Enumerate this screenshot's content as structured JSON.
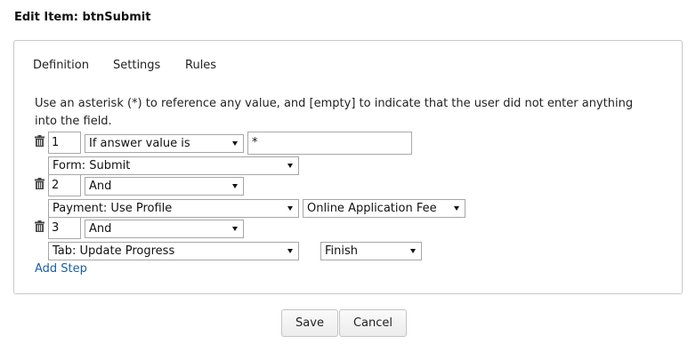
{
  "dialog": {
    "title": "Edit Item: btnSubmit"
  },
  "tabs": [
    {
      "label": "Definition"
    },
    {
      "label": "Settings"
    },
    {
      "label": "Rules"
    }
  ],
  "rules": {
    "description": "Use an asterisk (*) to reference any value, and [empty] to indicate that the user did not enter anything into the field.",
    "steps": [
      {
        "number": "1",
        "condition": "If answer value is",
        "value": "*",
        "action": "Form: Submit"
      },
      {
        "number": "2",
        "condition": "And",
        "action": "Payment: Use Profile",
        "action_option": "Online Application Fee"
      },
      {
        "number": "3",
        "condition": "And",
        "action": "Tab: Update Progress",
        "action_option": "Finish"
      }
    ],
    "add_step_label": "Add Step"
  },
  "buttons": {
    "save": "Save",
    "cancel": "Cancel"
  },
  "icons": {
    "delete_step": "trash-icon",
    "dropdown": "chevron-down-icon"
  },
  "colors": {
    "link": "#1a5ea8",
    "border": "#c9c9c9"
  }
}
